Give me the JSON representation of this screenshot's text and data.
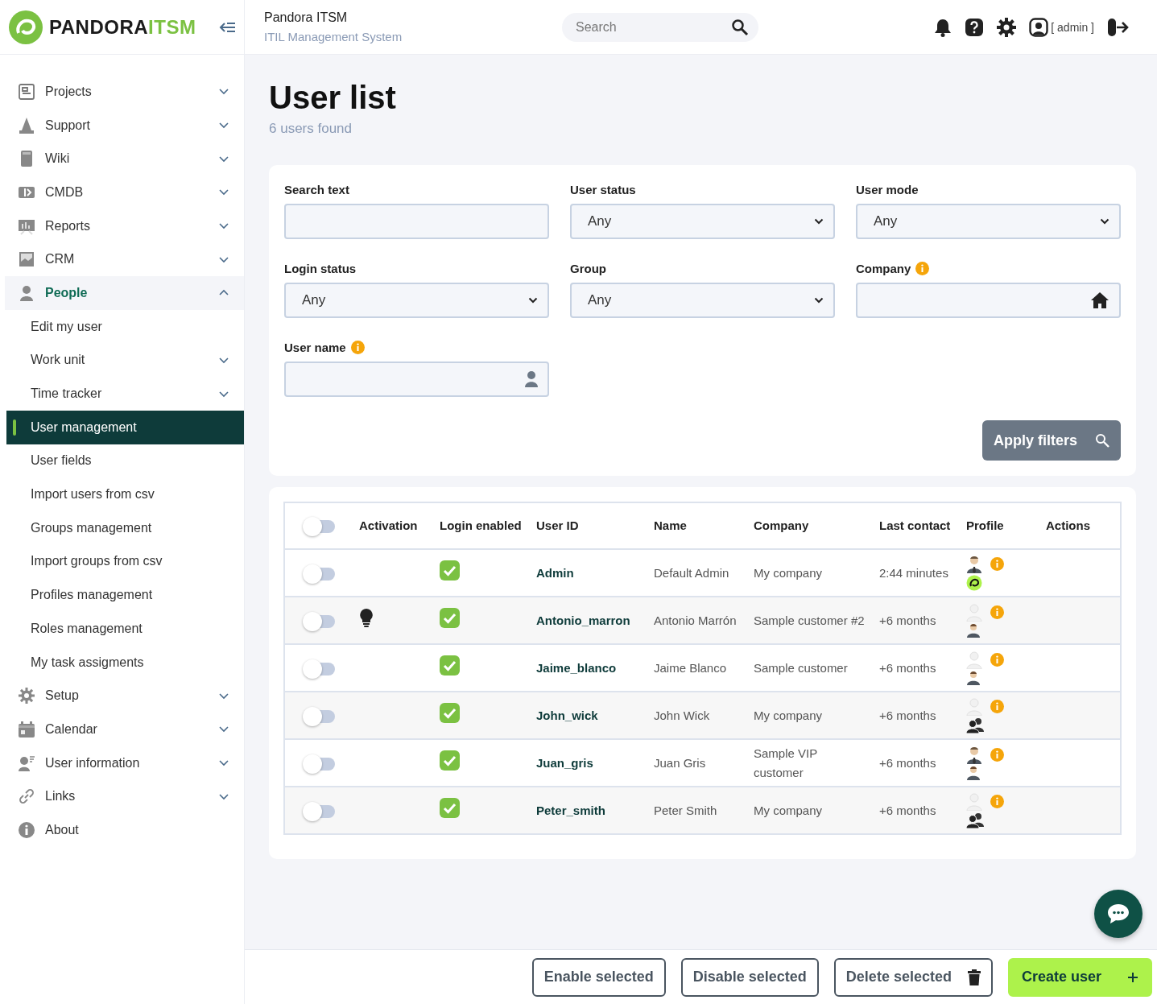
{
  "brand": {
    "logo_primary": "PANDORA",
    "logo_accent": "ITSM"
  },
  "header": {
    "app_title": "Pandora ITSM",
    "app_subtitle": "ITIL Management System",
    "search": {
      "placeholder": "Search"
    },
    "user_label": "[ admin ]"
  },
  "sidebar": {
    "items": [
      {
        "label": "Projects",
        "expanded": false,
        "selected": false
      },
      {
        "label": "Support",
        "expanded": false,
        "selected": false
      },
      {
        "label": "Wiki",
        "expanded": false,
        "selected": false
      },
      {
        "label": "CMDB",
        "expanded": false,
        "selected": false
      },
      {
        "label": "Reports",
        "expanded": false,
        "selected": false
      },
      {
        "label": "CRM",
        "expanded": false,
        "selected": false
      },
      {
        "label": "People",
        "expanded": true,
        "selected": false,
        "children": [
          {
            "label": "Edit my user",
            "selected": false
          },
          {
            "label": "Work unit",
            "expanded": false,
            "selected": false
          },
          {
            "label": "Time tracker",
            "expanded": false,
            "selected": false
          },
          {
            "label": "User management",
            "selected": true
          },
          {
            "label": "User fields",
            "selected": false
          },
          {
            "label": "Import users from csv",
            "selected": false
          },
          {
            "label": "Groups management",
            "selected": false
          },
          {
            "label": "Import groups from csv",
            "selected": false
          },
          {
            "label": "Profiles management",
            "selected": false
          },
          {
            "label": "Roles management",
            "selected": false
          },
          {
            "label": "My task assigments",
            "selected": false
          }
        ]
      },
      {
        "label": "Setup",
        "expanded": false,
        "selected": false
      },
      {
        "label": "Calendar",
        "expanded": false,
        "selected": false
      },
      {
        "label": "User information",
        "expanded": false,
        "selected": false
      },
      {
        "label": "Links",
        "expanded": false,
        "selected": false
      },
      {
        "label": "About",
        "selected": false
      }
    ]
  },
  "page": {
    "title": "User list",
    "subtitle": "6 users found"
  },
  "filters": {
    "fields": [
      {
        "label": "Search text",
        "kind": "text"
      },
      {
        "label": "User status",
        "kind": "select",
        "value": "Any"
      },
      {
        "label": "User mode",
        "kind": "select",
        "value": "Any"
      },
      {
        "label": "Login status",
        "kind": "select",
        "value": "Any"
      },
      {
        "label": "Group",
        "kind": "select",
        "value": "Any"
      },
      {
        "label": "Company",
        "kind": "company",
        "info": true
      },
      {
        "label": "User name",
        "kind": "user",
        "info": true
      }
    ],
    "apply_button": "Apply filters"
  },
  "table": {
    "select_all": false,
    "columns": [
      "Activation",
      "Login enabled",
      "User ID",
      "Name",
      "Company",
      "Last contact",
      "Profile",
      "Actions"
    ],
    "rows": [
      {
        "selected": false,
        "activation": false,
        "login_enabled": true,
        "user_id": "Admin",
        "name": "Default Admin",
        "company": "My company",
        "last_contact": "2:44 minutes",
        "profile": [
          {
            "kind": "manager"
          },
          {
            "kind": "logo"
          }
        ],
        "info": true
      },
      {
        "selected": false,
        "activation": true,
        "login_enabled": true,
        "user_id": "Antonio_marron",
        "name": "Antonio Marrón",
        "company": "Sample customer #2",
        "last_contact": "+6 months",
        "profile": [
          {
            "kind": "blank"
          },
          {
            "kind": "person"
          }
        ],
        "info": true
      },
      {
        "selected": false,
        "activation": false,
        "login_enabled": true,
        "user_id": "Jaime_blanco",
        "name": "Jaime Blanco",
        "company": "Sample customer",
        "last_contact": "+6 months",
        "profile": [
          {
            "kind": "blank"
          },
          {
            "kind": "person"
          }
        ],
        "info": true
      },
      {
        "selected": false,
        "activation": false,
        "login_enabled": true,
        "user_id": "John_wick",
        "name": "John Wick",
        "company": "My company",
        "last_contact": "+6 months",
        "profile": [
          {
            "kind": "blank"
          },
          {
            "kind": "group"
          }
        ],
        "info": true
      },
      {
        "selected": false,
        "activation": false,
        "login_enabled": true,
        "user_id": "Juan_gris",
        "name": "Juan Gris",
        "company": "Sample VIP customer",
        "last_contact": "+6 months",
        "profile": [
          {
            "kind": "manager"
          },
          {
            "kind": "person"
          }
        ],
        "info": true
      },
      {
        "selected": false,
        "activation": false,
        "login_enabled": true,
        "user_id": "Peter_smith",
        "name": "Peter Smith",
        "company": "My company",
        "last_contact": "+6 months",
        "profile": [
          {
            "kind": "blank"
          },
          {
            "kind": "group"
          }
        ],
        "info": true
      }
    ]
  },
  "actions": [
    {
      "label": "Enable selected",
      "kind": "outline"
    },
    {
      "label": "Disable selected",
      "kind": "outline"
    },
    {
      "label": "Delete selected",
      "kind": "delete"
    },
    {
      "label": "Create user",
      "kind": "create"
    }
  ]
}
